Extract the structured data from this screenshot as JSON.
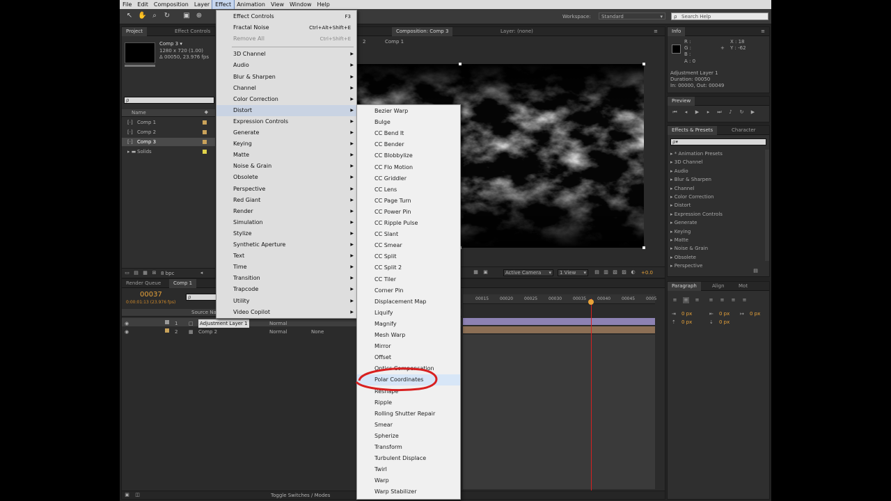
{
  "menubar": {
    "items": [
      "File",
      "Edit",
      "Composition",
      "Layer",
      "Effect",
      "Animation",
      "View",
      "Window",
      "Help"
    ],
    "active": "Effect"
  },
  "toolbar": {
    "workspace_label": "Workspace:",
    "workspace_value": "Standard",
    "search_placeholder": "Search Help"
  },
  "project_panel": {
    "tabs": [
      "Project",
      "Effect Controls"
    ],
    "comp_name": "Comp 3 ▾",
    "comp_info_1": "1280 x 720 (1.00)",
    "comp_info_2": "Δ 00050, 23.976 fps",
    "col_name": "Name",
    "items": [
      "Comp 1",
      "Comp 2",
      "Comp 3",
      "Solids"
    ],
    "bpc": "8 bpc"
  },
  "comp_viewer": {
    "tab_comp": "Composition: Comp 3",
    "tab_layer": "Layer: (none)",
    "breadcrumb_1": "Comp 1",
    "breadcrumb_2": "2",
    "camera": "Active Camera",
    "view": "1 View",
    "offset": "+0.0"
  },
  "info_panel": {
    "title": "Info",
    "rgba": [
      "R :",
      "G :",
      "B :",
      "A : 0"
    ],
    "xy": [
      "X : 18",
      "Y : -62"
    ],
    "details": [
      "Adjustment Layer 1",
      "Duration: 00050",
      "In: 00000, Out: 00049"
    ]
  },
  "preview_panel": {
    "title": "Preview"
  },
  "effects_panel": {
    "tabs": [
      "Effects & Presets",
      "Character"
    ],
    "search_placeholder": "ρ▾",
    "items": [
      "* Animation Presets",
      "3D Channel",
      "Audio",
      "Blur & Sharpen",
      "Channel",
      "Color Correction",
      "Distort",
      "Expression Controls",
      "Generate",
      "Keying",
      "Matte",
      "Noise & Grain",
      "Obsolete",
      "Perspective"
    ]
  },
  "paragraph_panel": {
    "tabs": [
      "Paragraph",
      "Align",
      "Mot"
    ],
    "fields": [
      "0 px",
      "0 px",
      "0 px",
      "0 px",
      "0 px"
    ]
  },
  "timeline": {
    "tabs": [
      "Render Queue",
      "Comp 1"
    ],
    "timecode": "00037",
    "timecode_sub": "0:00:01:13 (23.976 fps)",
    "col_source": "Source Name",
    "layers": [
      {
        "num": "1",
        "name": "Adjustment Layer 1",
        "mode": "Normal"
      },
      {
        "num": "2",
        "name": "Comp 2",
        "mode": "Normal",
        "trkmat": "None"
      }
    ],
    "ruler": [
      "00015",
      "00020",
      "00025",
      "00030",
      "00035",
      "00040",
      "00045",
      "0005"
    ],
    "toggle_label": "Toggle Switches / Modes"
  },
  "effect_menu": {
    "items": [
      {
        "label": "Effect Controls",
        "shortcut": "F3"
      },
      {
        "label": "Fractal Noise",
        "shortcut": "Ctrl+Alt+Shift+E"
      },
      {
        "label": "Remove All",
        "shortcut": "Ctrl+Shift+E",
        "disabled": true
      },
      {
        "label": "3D Channel",
        "arrow": true
      },
      {
        "label": "Audio",
        "arrow": true
      },
      {
        "label": "Blur & Sharpen",
        "arrow": true
      },
      {
        "label": "Channel",
        "arrow": true
      },
      {
        "label": "Color Correction",
        "arrow": true
      },
      {
        "label": "Distort",
        "arrow": true,
        "highlight": true
      },
      {
        "label": "Expression Controls",
        "arrow": true
      },
      {
        "label": "Generate",
        "arrow": true
      },
      {
        "label": "Keying",
        "arrow": true
      },
      {
        "label": "Matte",
        "arrow": true
      },
      {
        "label": "Noise & Grain",
        "arrow": true
      },
      {
        "label": "Obsolete",
        "arrow": true
      },
      {
        "label": "Perspective",
        "arrow": true
      },
      {
        "label": "Red Giant",
        "arrow": true
      },
      {
        "label": "Render",
        "arrow": true
      },
      {
        "label": "Simulation",
        "arrow": true
      },
      {
        "label": "Stylize",
        "arrow": true
      },
      {
        "label": "Synthetic Aperture",
        "arrow": true
      },
      {
        "label": "Text",
        "arrow": true
      },
      {
        "label": "Time",
        "arrow": true
      },
      {
        "label": "Transition",
        "arrow": true
      },
      {
        "label": "Trapcode",
        "arrow": true
      },
      {
        "label": "Utility",
        "arrow": true
      },
      {
        "label": "Video Copilot",
        "arrow": true
      }
    ]
  },
  "distort_submenu": {
    "items": [
      "Bezier Warp",
      "Bulge",
      "CC Bend It",
      "CC Bender",
      "CC Blobbylize",
      "CC Flo Motion",
      "CC Griddler",
      "CC Lens",
      "CC Page Turn",
      "CC Power Pin",
      "CC Ripple Pulse",
      "CC Slant",
      "CC Smear",
      "CC Split",
      "CC Split 2",
      "CC Tiler",
      "Corner Pin",
      "Displacement Map",
      "Liquify",
      "Magnify",
      "Mesh Warp",
      "Mirror",
      "Offset",
      "Optics Compensation",
      "Polar Coordinates",
      "Reshape",
      "Ripple",
      "Rolling Shutter Repair",
      "Smear",
      "Spherize",
      "Transform",
      "Turbulent Displace",
      "Twirl",
      "Warp",
      "Warp Stabilizer"
    ],
    "highlighted": "Polar Coordinates"
  },
  "colors": {
    "accent_orange": "#e8a33a",
    "annotation_red": "#d82020",
    "layer_bar_purple": "#8d82b3",
    "layer_bar_tan": "#8c6f55"
  }
}
